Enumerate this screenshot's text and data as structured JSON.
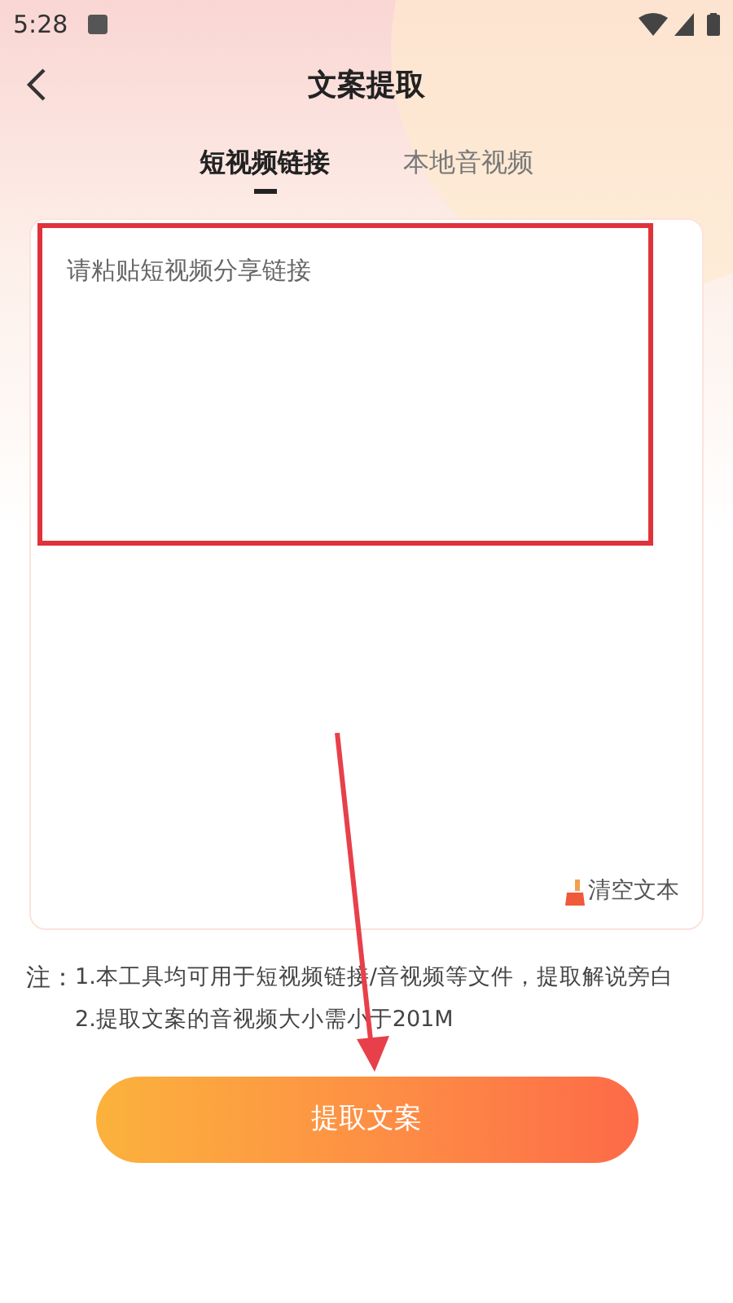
{
  "status_bar": {
    "time": "5:28"
  },
  "header": {
    "title": "文案提取"
  },
  "tabs": [
    {
      "label": "短视频链接",
      "selected": true
    },
    {
      "label": "本地音视频",
      "selected": false
    }
  ],
  "link_input": {
    "placeholder": "请粘贴短视频分享链接"
  },
  "clear_button": {
    "label": "清空文本"
  },
  "notes": {
    "label": "注：",
    "lines": [
      "1.本工具均可用于短视频链接/音视频等文件，提取解说旁白",
      "2.提取文案的音视频大小需小于201M"
    ]
  },
  "submit_button": {
    "label": "提取文案"
  }
}
